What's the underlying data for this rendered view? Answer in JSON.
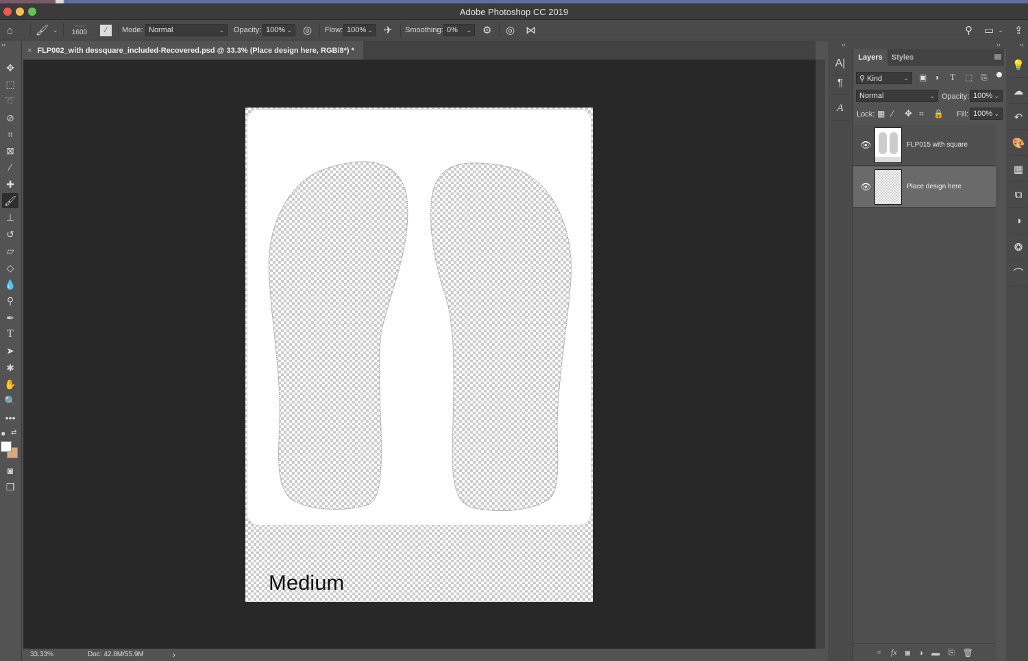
{
  "app": {
    "title": "Adobe Photoshop CC 2019"
  },
  "window_controls": {
    "close_color": "#ee5a52",
    "minimize_color": "#f4bf4f",
    "maximize_color": "#5fc454"
  },
  "options_bar": {
    "brush_size": "1600",
    "mode_label": "Mode:",
    "mode_value": "Normal",
    "opacity_label": "Opacity:",
    "opacity_value": "100%",
    "flow_label": "Flow:",
    "flow_value": "100%",
    "smoothing_label": "Smoothing:",
    "smoothing_value": "0%",
    "collapse_label": "››"
  },
  "document_tab": {
    "close_glyph": "×",
    "title": "FLP002_with dessquare_included-Recovered.psd @ 33.3% (Place design here, RGB/8*) *"
  },
  "canvas": {
    "size_label": "Medium",
    "swatch_foreground": "#ffffff",
    "swatch_background": "#d9aa7e"
  },
  "status_bar": {
    "zoom": "33.33%",
    "doc_size": "Doc: 42.8M/55.9M",
    "arrow": "›"
  },
  "panel_headers": {
    "collapse_left": "‹‹",
    "collapse_right": "››"
  },
  "layers_panel": {
    "tabs": [
      {
        "label": "Layers",
        "active": true
      },
      {
        "label": "Styles",
        "active": false
      }
    ],
    "filter_kind": "Kind",
    "blend_mode": "Normal",
    "opacity_label": "Opacity:",
    "opacity_value": "100%",
    "lock_label": "Lock:",
    "fill_label": "Fill:",
    "fill_value": "100%",
    "layers": [
      {
        "name": "FLP015 with square",
        "visible": true,
        "selected": false
      },
      {
        "name": "Place design here",
        "visible": true,
        "selected": true
      }
    ]
  }
}
